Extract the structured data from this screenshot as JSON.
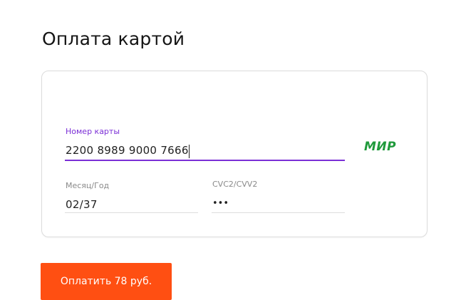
{
  "page": {
    "title": "Оплата картой"
  },
  "card_form": {
    "card_number": {
      "label": "Номер карты",
      "value": "2200 8989 9000 7666"
    },
    "expiry": {
      "label": "Месяц/Год",
      "value": "02/37"
    },
    "cvc": {
      "label": "CVC2/CVV2",
      "value": "•••"
    },
    "payment_system": {
      "name": "МИР",
      "logo_text": "МИР",
      "icon": "mir-logo-icon",
      "color": "#1f9a3b"
    }
  },
  "pay_button": {
    "label": "Оплатить 78 руб.",
    "color": "#ff4f12"
  },
  "colors": {
    "accent": "#7b2fd6",
    "button": "#ff4f12",
    "brand_mir": "#1f9a3b"
  }
}
